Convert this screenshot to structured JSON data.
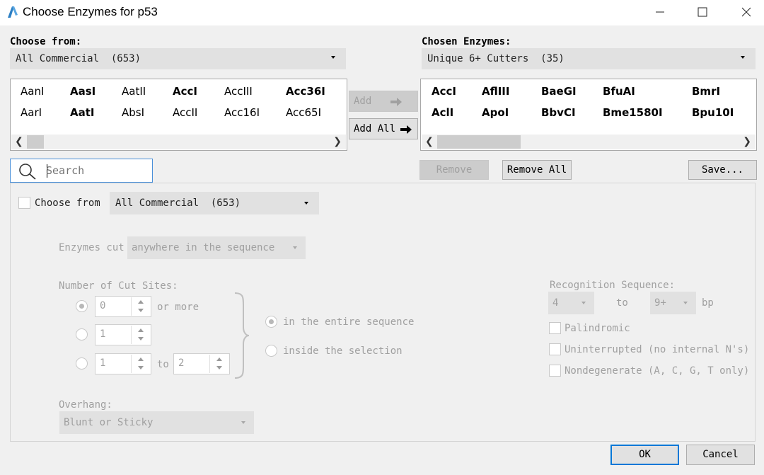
{
  "window": {
    "title": "Choose Enzymes for p53",
    "minimize_icon": "minimize-icon",
    "maximize_icon": "maximize-icon",
    "close_icon": "close-icon"
  },
  "left": {
    "label": "Choose from:",
    "combo_value": "All Commercial  (653)",
    "enzymes": [
      {
        "name": "AanI",
        "bold": false
      },
      {
        "name": "AasI",
        "bold": true
      },
      {
        "name": "AatII",
        "bold": false
      },
      {
        "name": "AccI",
        "bold": true
      },
      {
        "name": "AccIII",
        "bold": false
      },
      {
        "name": "Acc36I",
        "bold": true
      },
      {
        "name": "AarI",
        "bold": false
      },
      {
        "name": "AatI",
        "bold": true
      },
      {
        "name": "AbsI",
        "bold": false
      },
      {
        "name": "AccII",
        "bold": false
      },
      {
        "name": "Acc16I",
        "bold": false
      },
      {
        "name": "Acc65I",
        "bold": false
      }
    ]
  },
  "middle": {
    "add_label": "Add",
    "add_all_label": "Add All"
  },
  "right": {
    "label": "Chosen Enzymes:",
    "combo_value": "Unique 6+ Cutters  (35)",
    "enzymes": [
      {
        "name": "AccI",
        "bold": true
      },
      {
        "name": "AflIII",
        "bold": true
      },
      {
        "name": "BaeGI",
        "bold": true
      },
      {
        "name": "BfuAI",
        "bold": true
      },
      {
        "name": "BmrI",
        "bold": true
      },
      {
        "name": "AclI",
        "bold": true
      },
      {
        "name": "ApoI",
        "bold": true
      },
      {
        "name": "BbvCI",
        "bold": true
      },
      {
        "name": "Bme1580I",
        "bold": true
      },
      {
        "name": "Bpu10I",
        "bold": true
      }
    ],
    "remove_label": "Remove",
    "remove_all_label": "Remove All",
    "save_label": "Save..."
  },
  "search": {
    "placeholder": "Search",
    "icon": "search-icon"
  },
  "filter": {
    "choose_from_label": "Choose from",
    "choose_from_value": "All Commercial  (653)",
    "enzymes_cut_label": "Enzymes cut",
    "enzymes_cut_value": "anywhere in the sequence",
    "cut_sites_label": "Number of Cut Sites:",
    "row1_value": "0",
    "row1_suffix": "or more",
    "row2_value": "1",
    "row3_from": "1",
    "row3_to_label": "to",
    "row3_to": "2",
    "scope_entire": "in the entire sequence",
    "scope_selection": "inside the selection",
    "overhang_label": "Overhang:",
    "overhang_value": "Blunt or Sticky",
    "recog_label": "Recognition Sequence:",
    "recog_from": "4",
    "recog_to_label": "to",
    "recog_to": "9+",
    "recog_unit": "bp",
    "palindromic": "Palindromic",
    "uninterrupted": "Uninterrupted (no internal N's)",
    "nondegenerate": "Nondegenerate (A, C, G, T only)"
  },
  "footer": {
    "ok_label": "OK",
    "cancel_label": "Cancel"
  },
  "colors": {
    "app_icon": "#2c7fc4",
    "search_border": "#4a90d9",
    "ok_border": "#0078d7"
  }
}
